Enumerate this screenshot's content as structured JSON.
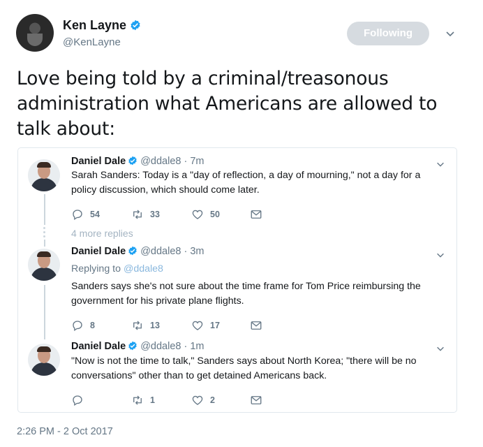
{
  "author": {
    "name": "Ken Layne",
    "handle": "@KenLayne"
  },
  "follow_button": {
    "label": "Following"
  },
  "tweet": {
    "text": "Love being told by a criminal/treasonous administration what Americans are allowed to talk about:",
    "timestamp": "2:26 PM - 2 Oct 2017"
  },
  "quoted_thread": {
    "more_replies_label": "4 more replies",
    "replies": [
      {
        "name": "Daniel Dale",
        "handle": "@ddale8",
        "time": "· 7m",
        "replying_to": "",
        "text": "Sarah Sanders: Today is a \"day of reflection, a day of mourning,\" not a day for a policy discussion, which should come later.",
        "replies": "54",
        "retweets": "33",
        "likes": "50"
      },
      {
        "name": "Daniel Dale",
        "handle": "@ddale8",
        "time": "· 3m",
        "replying_prefix": "Replying to",
        "replying_to": "@ddale8",
        "text": "Sanders says she's not sure about the time frame for Tom Price reimbursing the government for his private plane flights.",
        "replies": "8",
        "retweets": "13",
        "likes": "17"
      },
      {
        "name": "Daniel Dale",
        "handle": "@ddale8",
        "time": "· 1m",
        "replying_to": "",
        "text": "\"Now is not the time to talk,\" Sanders says about North Korea; \"there will be no conversations\" other than to get detained Americans back.",
        "replies": "",
        "retweets": "1",
        "likes": "2"
      }
    ]
  },
  "icons": {
    "verified": "verified-badge-icon",
    "caret": "chevron-down-icon",
    "reply": "reply-icon",
    "retweet": "retweet-icon",
    "like": "heart-icon",
    "message": "envelope-icon"
  },
  "colors": {
    "verified_blue": "#1da1f2",
    "text": "#14171a",
    "muted": "#657786",
    "follow_bg": "#d6dbe0",
    "border": "#e1e8ed"
  }
}
